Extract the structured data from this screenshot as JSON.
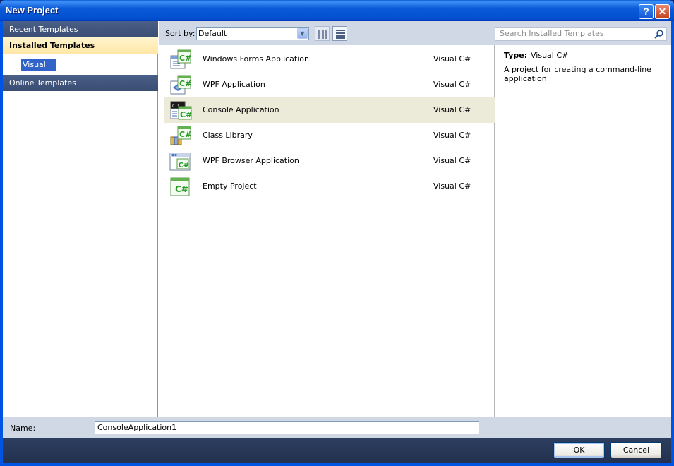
{
  "window": {
    "title": "New Project",
    "help_label": "?",
    "close_label": "✕"
  },
  "sidebar": {
    "recent": "Recent Templates",
    "installed": "Installed Templates",
    "installed_child": "Visual C#",
    "online": "Online Templates"
  },
  "toolbar": {
    "sort_label": "Sort by:",
    "sort_value": "Default",
    "search_placeholder": "Search Installed Templates"
  },
  "templates": [
    {
      "name": "Windows Forms Application",
      "type": "Visual C#",
      "icon": "winforms-csharp-icon"
    },
    {
      "name": "WPF Application",
      "type": "Visual C#",
      "icon": "wpf-csharp-icon"
    },
    {
      "name": "Console Application",
      "type": "Visual C#",
      "icon": "console-csharp-icon",
      "selected": true
    },
    {
      "name": "Class Library",
      "type": "Visual C#",
      "icon": "class-library-csharp-icon"
    },
    {
      "name": "WPF Browser Application",
      "type": "Visual C#",
      "icon": "wpf-browser-csharp-icon"
    },
    {
      "name": "Empty Project",
      "type": "Visual C#",
      "icon": "empty-project-csharp-icon"
    }
  ],
  "description": {
    "type_label": "Type:",
    "type_value": "Visual C#",
    "text": "A project for creating a command-line application"
  },
  "name_field": {
    "label": "Name:",
    "value": "ConsoleApplication1"
  },
  "buttons": {
    "ok": "OK",
    "cancel": "Cancel"
  },
  "colors": {
    "titlebar": "#0054e3",
    "selected_row": "#ecead9",
    "active_category": "#ffe8a6",
    "category_header": "#3a4d73",
    "csharp_green": "#2a9a2a"
  }
}
